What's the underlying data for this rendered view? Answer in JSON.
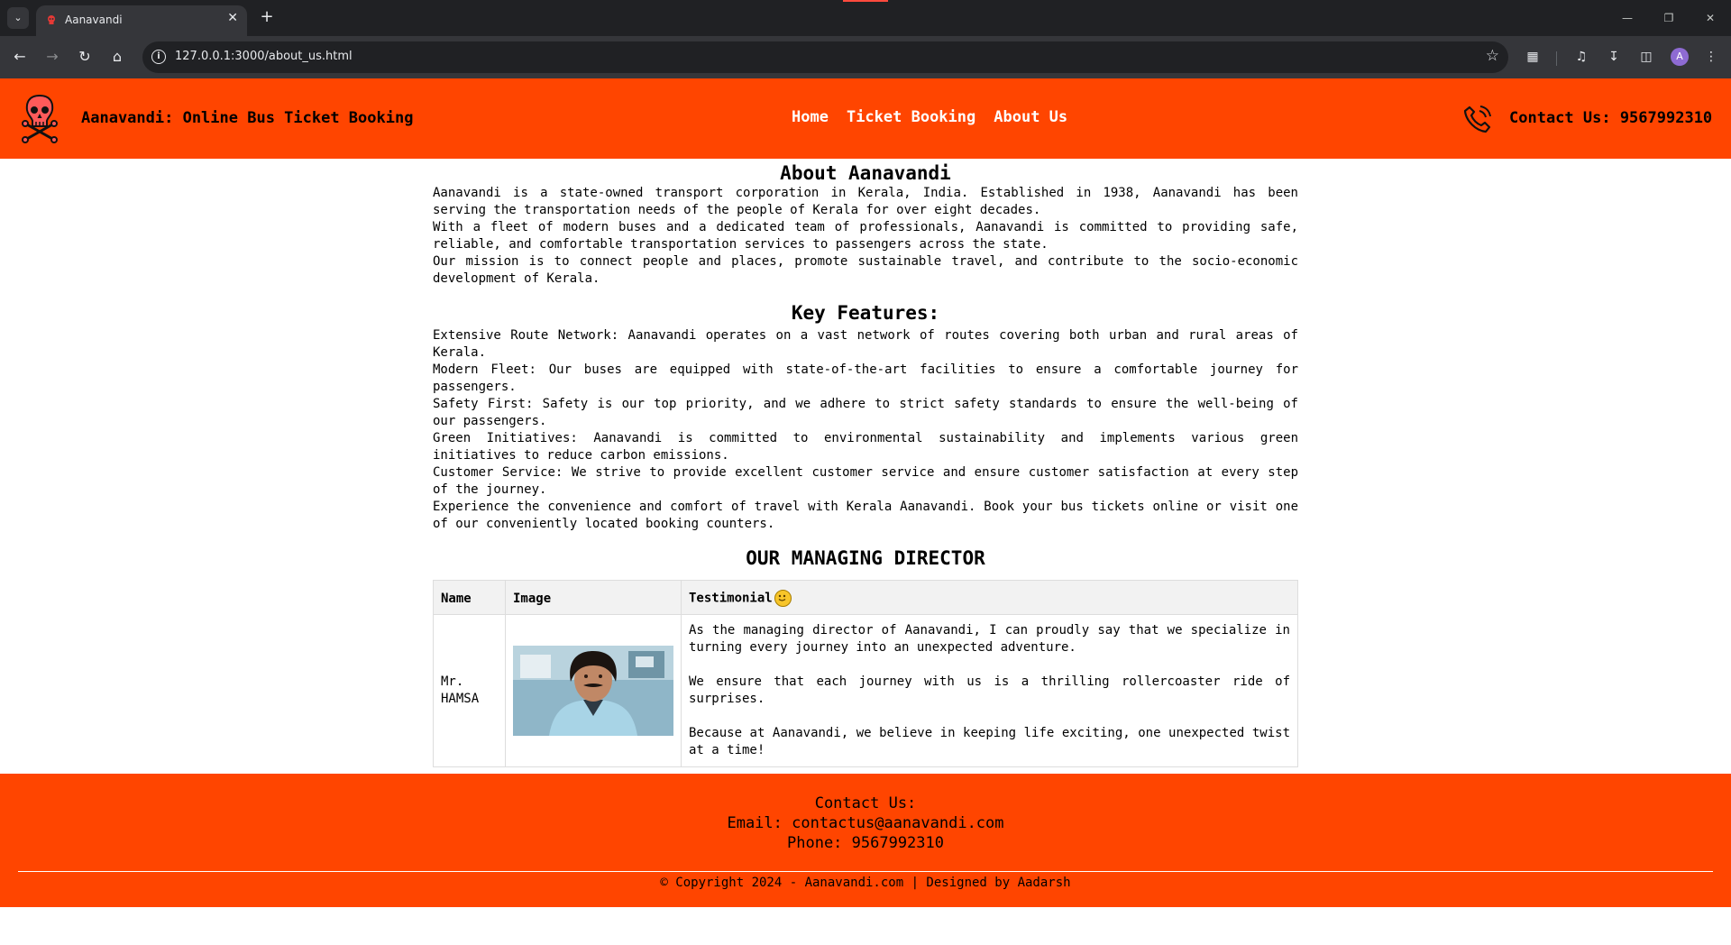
{
  "browser": {
    "tab_title": "Aanavandi",
    "url": "127.0.0.1:3000/about_us.html",
    "profile_initial": "A"
  },
  "header": {
    "brand": "Aanavandi: Online Bus Ticket Booking",
    "nav": [
      "Home",
      "Ticket Booking",
      "About Us"
    ],
    "contact": "Contact Us: 9567992310"
  },
  "about": {
    "title": "About Aanavandi",
    "paragraphs": [
      "Aanavandi is a state-owned transport corporation in Kerala, India. Established in 1938, Aanavandi has been serving the transportation needs of the people of Kerala for over eight decades.",
      "With a fleet of modern buses and a dedicated team of professionals, Aanavandi is committed to providing safe, reliable, and comfortable transportation services to passengers across the state.",
      "Our mission is to connect people and places, promote sustainable travel, and contribute to the socio-economic development of Kerala."
    ]
  },
  "features": {
    "title": "Key Features:",
    "items": [
      "Extensive Route Network: Aanavandi operates on a vast network of routes covering both urban and rural areas of Kerala.",
      "Modern Fleet: Our buses are equipped with state-of-the-art facilities to ensure a comfortable journey for passengers.",
      "Safety First: Safety is our top priority, and we adhere to strict safety standards to ensure the well-being of our passengers.",
      "Green Initiatives: Aanavandi is committed to environmental sustainability and implements various green initiatives to reduce carbon emissions.",
      "Customer Service: We strive to provide excellent customer service and ensure customer satisfaction at every step of the journey."
    ],
    "closing": "Experience the convenience and comfort of travel with Kerala Aanavandi. Book your bus tickets online or visit one of our conveniently located booking counters."
  },
  "director": {
    "title": "OUR MANAGING DIRECTOR",
    "columns": [
      "Name",
      "Image",
      "Testimonial"
    ],
    "name": "Mr. HAMSA",
    "testimonial": [
      "As the managing director of Aanavandi, I can proudly say that we specialize in turning every journey into an unexpected adventure.",
      "We ensure that each journey with us is a thrilling rollercoaster ride of surprises.",
      "Because at Aanavandi, we believe in keeping life exciting, one unexpected twist at a time!"
    ]
  },
  "footer": {
    "heading": "Contact Us:",
    "email": "Email: contactus@aanavandi.com",
    "phone": "Phone: 9567992310",
    "copyright": "© Copyright 2024 - Aanavandi.com | Designed by Aadarsh"
  },
  "colors": {
    "brand_orange": "#ff4500",
    "nav_text": "#ffffff"
  }
}
